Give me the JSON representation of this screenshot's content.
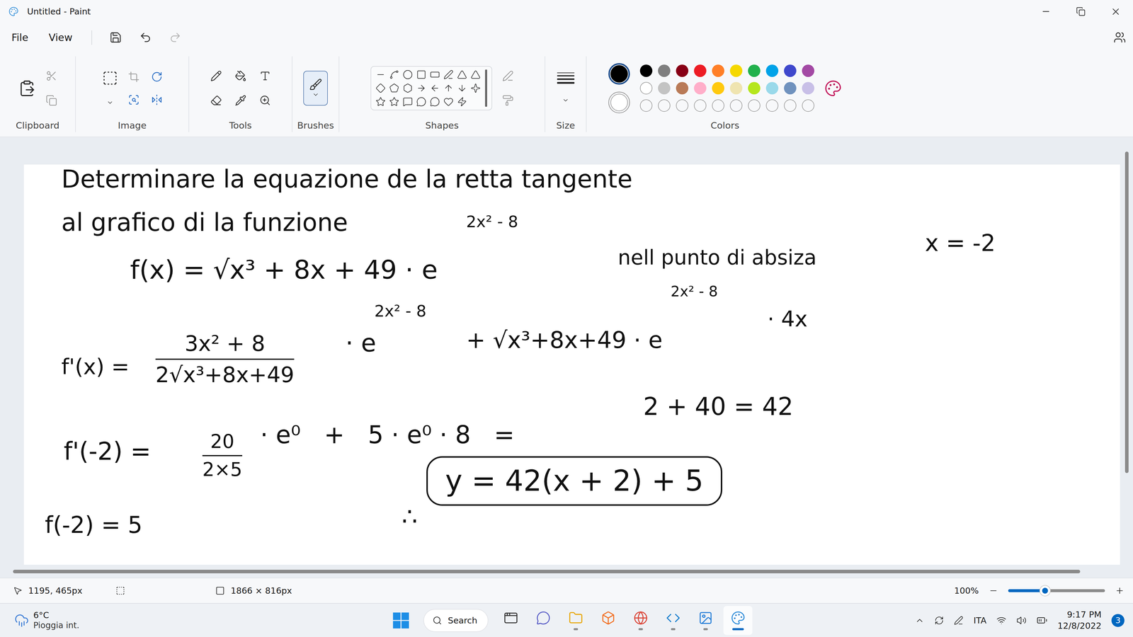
{
  "window": {
    "title": "Untitled - Paint"
  },
  "menu": [
    "File",
    "View"
  ],
  "history": {
    "undo_enabled": true,
    "redo_enabled": false
  },
  "ribbon": {
    "groups": [
      "Clipboard",
      "Image",
      "Tools",
      "Brushes",
      "Shapes",
      "Size",
      "Colors"
    ]
  },
  "colors": {
    "primary": "#000000",
    "secondary": "#ffffff",
    "palette": [
      {
        "color": "#000000",
        "empty": false
      },
      {
        "color": "#7f7f7f",
        "empty": false
      },
      {
        "color": "#880015",
        "empty": false
      },
      {
        "color": "#ed1c24",
        "empty": false
      },
      {
        "color": "#ff7f27",
        "empty": false
      },
      {
        "color": "#f5d800",
        "empty": false
      },
      {
        "color": "#22b14c",
        "empty": false
      },
      {
        "color": "#00a2e8",
        "empty": false
      },
      {
        "color": "#3f48cc",
        "empty": false
      },
      {
        "color": "#a349a4",
        "empty": false
      },
      {
        "color": "#ffffff",
        "empty": false
      },
      {
        "color": "#c3c3c3",
        "empty": false
      },
      {
        "color": "#b97a57",
        "empty": false
      },
      {
        "color": "#ffaec9",
        "empty": false
      },
      {
        "color": "#ffc90e",
        "empty": false
      },
      {
        "color": "#efe4b0",
        "empty": false
      },
      {
        "color": "#b5e61d",
        "empty": false
      },
      {
        "color": "#99d9ea",
        "empty": false
      },
      {
        "color": "#7092be",
        "empty": false
      },
      {
        "color": "#c8bfe7",
        "empty": false
      },
      {
        "color": "#ffffff",
        "empty": true
      },
      {
        "color": "#ffffff",
        "empty": true
      },
      {
        "color": "#ffffff",
        "empty": true
      },
      {
        "color": "#ffffff",
        "empty": true
      },
      {
        "color": "#ffffff",
        "empty": true
      },
      {
        "color": "#ffffff",
        "empty": true
      },
      {
        "color": "#ffffff",
        "empty": true
      },
      {
        "color": "#ffffff",
        "empty": true
      },
      {
        "color": "#ffffff",
        "empty": true
      },
      {
        "color": "#ffffff",
        "empty": true
      }
    ]
  },
  "canvas": {
    "items": [
      {
        "kind": "text",
        "text": "Determinare la equazione de la retta tangente"
      },
      {
        "kind": "text",
        "text": "al grafico di la funzione"
      },
      {
        "kind": "text",
        "text": "2x² - 8"
      },
      {
        "kind": "text",
        "text": "f(x) = √x³ + 8x + 49 · e"
      },
      {
        "kind": "text",
        "text": "nell punto di absiza"
      },
      {
        "kind": "text",
        "text": "x = -2"
      },
      {
        "kind": "text",
        "text": "2x² - 8"
      },
      {
        "kind": "text",
        "text": "2x² - 8"
      },
      {
        "kind": "text",
        "text": "f'(x) ="
      },
      {
        "kind": "fraction",
        "num": "3x² + 8",
        "den": "2√x³+8x+49"
      },
      {
        "kind": "text",
        "text": "· e"
      },
      {
        "kind": "text",
        "text": "+ √x³+8x+49 · e"
      },
      {
        "kind": "text",
        "text": "· 4x"
      },
      {
        "kind": "text",
        "text": "f'(-2) ="
      },
      {
        "kind": "fraction",
        "num": "20",
        "den": "2×5"
      },
      {
        "kind": "text",
        "text": "· e⁰   +   5 · e⁰ · 8   ="
      },
      {
        "kind": "text",
        "text": "2 + 40 = 42"
      },
      {
        "kind": "text",
        "text": "f(-2) = 5"
      },
      {
        "kind": "text",
        "text": "∴"
      },
      {
        "kind": "boxed",
        "text": "y = 42(x + 2) + 5"
      }
    ]
  },
  "status_bar": {
    "cursor": "1195, 465px",
    "size": "1866 × 816px",
    "zoom": "100%",
    "zoom_level": 0.38
  },
  "taskbar": {
    "weather": {
      "temp": "6°C",
      "desc": "Pioggia int."
    },
    "search": "Search",
    "apps": [
      {
        "running": false,
        "selected": false
      },
      {
        "running": false,
        "selected": false
      },
      {
        "running": true,
        "selected": false
      },
      {
        "running": false,
        "selected": false
      },
      {
        "running": true,
        "selected": false
      },
      {
        "running": true,
        "selected": false
      },
      {
        "running": true,
        "selected": false
      },
      {
        "running": true,
        "selected": true
      }
    ],
    "language": "ITA",
    "time": "9:17 PM",
    "date": "12/8/2022",
    "notifications": "3"
  }
}
